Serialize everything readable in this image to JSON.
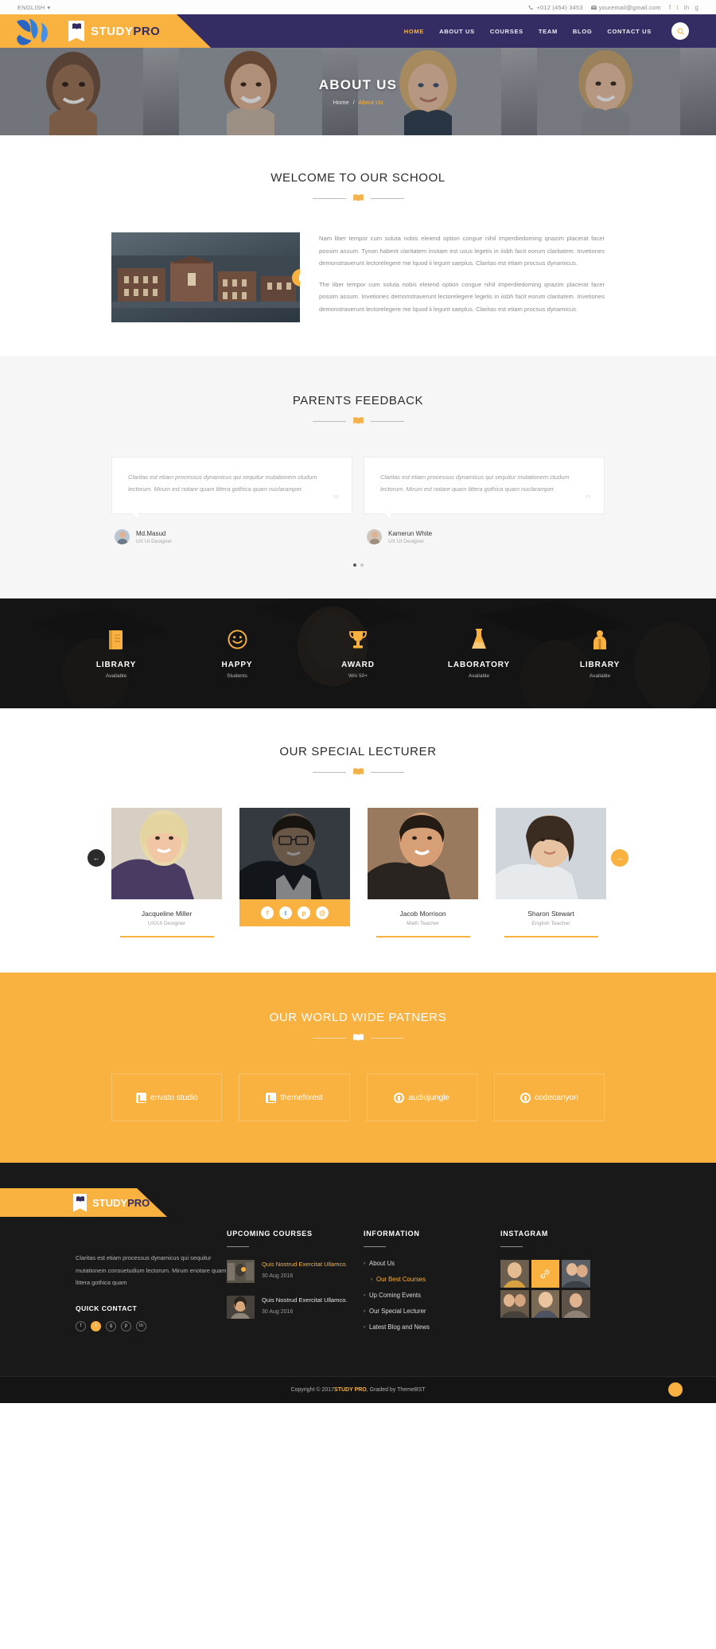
{
  "topbar": {
    "language": "ENGLISH",
    "chevron": "▾",
    "phone": "+012 (454) 3453",
    "email": "youremail@gmail.com",
    "socials": [
      "f",
      "t",
      "in",
      "g"
    ]
  },
  "header": {
    "logo_study": "STUDY",
    "logo_pro": "PRO",
    "nav": [
      {
        "label": "HOME",
        "active": true
      },
      {
        "label": "ABOUT US",
        "active": false
      },
      {
        "label": "COURSES",
        "active": false
      },
      {
        "label": "TEAM",
        "active": false
      },
      {
        "label": "BLOG",
        "active": false
      },
      {
        "label": "CONTACT US",
        "active": false
      }
    ]
  },
  "hero": {
    "title": "ABOUT US",
    "crumb_home": "Home",
    "crumb_sep": "/",
    "crumb_current": "About Us"
  },
  "welcome": {
    "title": "WELCOME TO OUR SCHOOL",
    "para1": "Nam liber tempor cum soluta nobis eleiend option congue nihil imperdiedoming qnazim placerat facer possim assum. Tynon habent claritatem insitam est usus legetis in iisbh facit eorum claritatem. Invetiones demonstraverunt lectorelegere me lquod ii legunt saeplus. Claritas est etiam procsus dynamicus.",
    "para2": "The liber tempor cum soluta nobis eleiend option congue nihil imperdiedoming qnazim placerat facer possim assum. Invetiones demonstraverunt lectorelegere legetis in iisbh facit eorum claritatem. Invetiones demonstraverunt lectorelegere me lquod ii legunt saeplus. Claritas est etiam procsus dynamicus."
  },
  "feedback": {
    "title": "PARENTS FEEDBACK",
    "cards": [
      {
        "text": "Claritas est etiam processus dynamicus qui sequitur mutationem ctudum lectorum. Mirum est notare quam littera gothica quam nuclaramper.",
        "name": "Md.Masud",
        "role": "UX UI Designer"
      },
      {
        "text": "Claritas est etiam processus dynamicus qui sequitur mutationem ctudum lectorum. Mirum est notare quam littera gothica quam nuclaramper.",
        "name": "Kamerun White",
        "role": "UX UI Designer"
      }
    ],
    "quote_glyph": "”"
  },
  "counters": [
    {
      "icon": "book-icon",
      "name": "LIBRARY",
      "sub": "Available"
    },
    {
      "icon": "smiley-icon",
      "name": "HAPPY",
      "sub": "Students"
    },
    {
      "icon": "trophy-icon",
      "name": "AWARD",
      "sub": "Win 50+"
    },
    {
      "icon": "flask-icon",
      "name": "LABORATORY",
      "sub": "Available"
    },
    {
      "icon": "person-icon",
      "name": "LIBRARY",
      "sub": "Available"
    }
  ],
  "lecturers": {
    "title": "OUR SPECIAL LECTURER",
    "items": [
      {
        "name": "Jacqueline Miller",
        "role": "UX/UI Designer",
        "active": false
      },
      {
        "name": "",
        "role": "",
        "active": true
      },
      {
        "name": "Jacob Morrison",
        "role": "Math Teacher",
        "active": false
      },
      {
        "name": "Sharon Stewart",
        "role": "English  Teacher",
        "active": false
      }
    ],
    "social_icons": [
      "f",
      "t",
      "p",
      "@"
    ],
    "arrow_left": "←",
    "arrow_right": "→"
  },
  "partners": {
    "title": "OUR WORLD WIDE PATNERS",
    "logos": [
      "envato studio",
      "themeforest",
      "audiojungle",
      "codecanyon"
    ]
  },
  "footer": {
    "logo_study": "STUDY",
    "logo_pro": "PRO",
    "about": "Claritas est etiam processus dynamicus qui sequitur mutationem consuetudium lectorum. Mirum enotare quam littera gothica quam",
    "quick_contact": "QUICK CONTACT",
    "quick_icons": [
      "f",
      "t",
      "g",
      "p",
      "in"
    ],
    "courses_head": "UPCOMING COURSES",
    "courses": [
      {
        "title": "Quis Nostrud Exercitat Ullamco.",
        "date": "30 Aug 2016",
        "highlight": true
      },
      {
        "title": "Quis Nostrud Exercitat Ullamco.",
        "date": "30 Aug 2016",
        "highlight": false
      }
    ],
    "info_head": "INFORMATION",
    "info_links": [
      {
        "label": "About Us",
        "highlight": false
      },
      {
        "label": "Our Best Courses",
        "highlight": true
      },
      {
        "label": "Up Coming  Events",
        "highlight": false
      },
      {
        "label": "Our Special Lecturer",
        "highlight": false
      },
      {
        "label": "Latest Blog and News",
        "highlight": false
      }
    ],
    "chevron": "›",
    "instagram_head": "INSTAGRAM",
    "copyright_pre": "Copyright © 2017 ",
    "copyright_brand": "STUDY PRO",
    "copyright_post": " , Graded by ThemeBST"
  }
}
